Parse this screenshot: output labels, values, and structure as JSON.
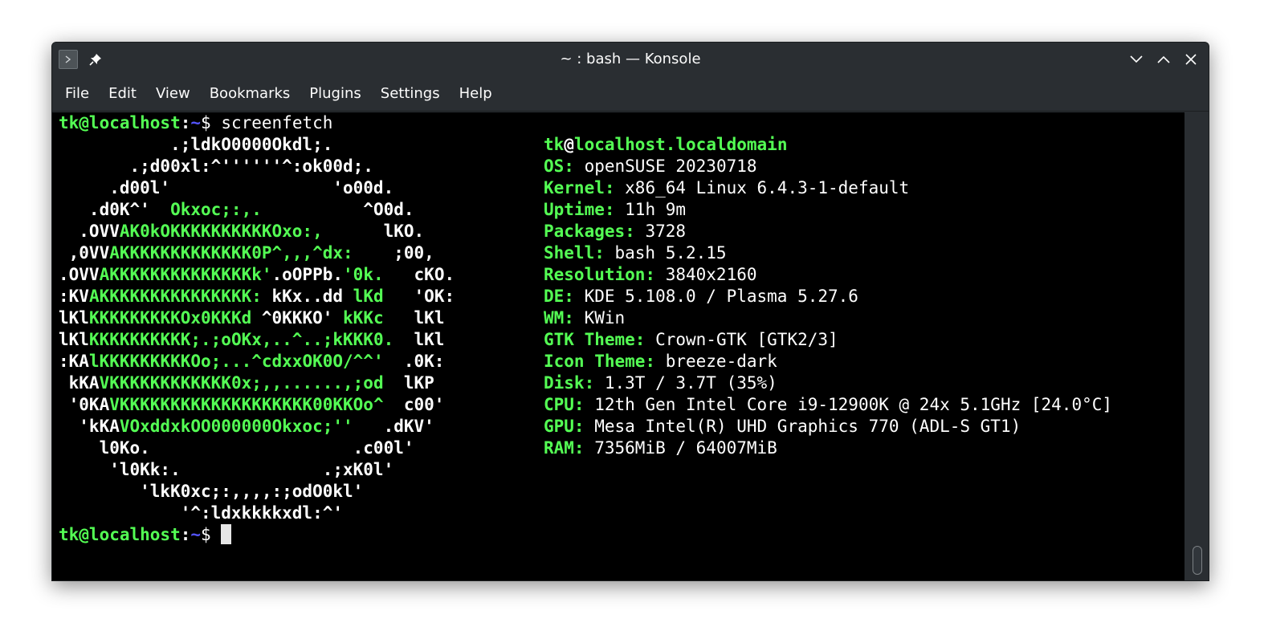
{
  "window": {
    "title": "~ : bash — Konsole"
  },
  "menubar": {
    "items": [
      "File",
      "Edit",
      "View",
      "Bookmarks",
      "Plugins",
      "Settings",
      "Help"
    ]
  },
  "prompt": {
    "user_host": "tk@localhost",
    "sep": ":",
    "path": "~",
    "symbol": "$ ",
    "command": "screenfetch"
  },
  "logo": [
    [
      {
        "t": "           .;ldkO0000Okdl;.",
        "c": "wb"
      }
    ],
    [
      {
        "t": "       .;d00xl:^''''''^:ok00d;.",
        "c": "wb"
      }
    ],
    [
      {
        "t": "     .d00l'                'o00d.",
        "c": "wb"
      }
    ],
    [
      {
        "t": "   .d0K^'  ",
        "c": "wb"
      },
      {
        "t": "Okxoc;:,.",
        "c": "g"
      },
      {
        "t": "          ^O0d.",
        "c": "wb"
      }
    ],
    [
      {
        "t": "  .OVV",
        "c": "wb"
      },
      {
        "t": "AK0kOKKKKKKKKKKOxo:,",
        "c": "g"
      },
      {
        "t": "      lKO.",
        "c": "wb"
      }
    ],
    [
      {
        "t": " ,0VV",
        "c": "wb"
      },
      {
        "t": "AKKKKKKKKKKKKK0P^,,,^dx:",
        "c": "g"
      },
      {
        "t": "    ;00,",
        "c": "wb"
      }
    ],
    [
      {
        "t": ".OVV",
        "c": "wb"
      },
      {
        "t": "AKKKKKKKKKKKKKKk'",
        "c": "g"
      },
      {
        "t": ".oOPPb.",
        "c": "wb"
      },
      {
        "t": "'0k.",
        "c": "g"
      },
      {
        "t": "   cKO.",
        "c": "wb"
      }
    ],
    [
      {
        "t": ":KV",
        "c": "wb"
      },
      {
        "t": "AKKKKKKKKKKKKKKK:",
        "c": "g"
      },
      {
        "t": " kKx..dd ",
        "c": "wb"
      },
      {
        "t": "lKd",
        "c": "g"
      },
      {
        "t": "   'OK:",
        "c": "wb"
      }
    ],
    [
      {
        "t": "lKl",
        "c": "wb"
      },
      {
        "t": "KKKKKKKKKOx0KKKd",
        "c": "g"
      },
      {
        "t": " ^0KKKO' ",
        "c": "wb"
      },
      {
        "t": "kKKc",
        "c": "g"
      },
      {
        "t": "   lKl",
        "c": "wb"
      }
    ],
    [
      {
        "t": "lKl",
        "c": "wb"
      },
      {
        "t": "KKKKKKKKKK;.;oOKx,..^..;kKKK0.",
        "c": "g"
      },
      {
        "t": "  lKl",
        "c": "wb"
      }
    ],
    [
      {
        "t": ":KA",
        "c": "wb"
      },
      {
        "t": "lKKKKKKKKKOo;...^cdxxOK0O/^^'",
        "c": "g"
      },
      {
        "t": "  .0K:",
        "c": "wb"
      }
    ],
    [
      {
        "t": " kKA",
        "c": "wb"
      },
      {
        "t": "VKKKKKKKKKKKK0x;,,......,;od",
        "c": "g"
      },
      {
        "t": "  lKP",
        "c": "wb"
      }
    ],
    [
      {
        "t": " '0KA",
        "c": "wb"
      },
      {
        "t": "VKKKKKKKKKKKKKKKKKKK00KKOo^",
        "c": "g"
      },
      {
        "t": "  c00'",
        "c": "wb"
      }
    ],
    [
      {
        "t": "  'kKA",
        "c": "wb"
      },
      {
        "t": "VOxddxkOO000000Okxoc;''",
        "c": "g"
      },
      {
        "t": "   .dKV'",
        "c": "wb"
      }
    ],
    [
      {
        "t": "    l0Ko.                    .c00l'",
        "c": "wb"
      }
    ],
    [
      {
        "t": "     'l0Kk:.              .;xK0l'",
        "c": "wb"
      }
    ],
    [
      {
        "t": "        'lkK0xc;:,,,,:;odO0kl'",
        "c": "wb"
      }
    ],
    [
      {
        "t": "            '^:ldxkkkkxdl:^'",
        "c": "wb"
      }
    ]
  ],
  "info": {
    "user": "tk",
    "at": "@",
    "host": "localhost.localdomain",
    "rows": [
      {
        "key": "OS:",
        "value": " openSUSE 20230718"
      },
      {
        "key": "Kernel:",
        "value": " x86_64 Linux 6.4.3-1-default"
      },
      {
        "key": "Uptime:",
        "value": " 11h 9m"
      },
      {
        "key": "Packages:",
        "value": " 3728"
      },
      {
        "key": "Shell:",
        "value": " bash 5.2.15"
      },
      {
        "key": "Resolution:",
        "value": " 3840x2160"
      },
      {
        "key": "DE:",
        "value": " KDE 5.108.0 / Plasma 5.27.6"
      },
      {
        "key": "WM:",
        "value": " KWin"
      },
      {
        "key": "GTK Theme:",
        "value": " Crown-GTK [GTK2/3]"
      },
      {
        "key": "Icon Theme:",
        "value": " breeze-dark"
      },
      {
        "key": "Disk:",
        "value": " 1.3T / 3.7T (35%)"
      },
      {
        "key": "CPU:",
        "value": " 12th Gen Intel Core i9-12900K @ 24x 5.1GHz [24.0°C]"
      },
      {
        "key": "GPU:",
        "value": " Mesa Intel(R) UHD Graphics 770 (ADL-S GT1)"
      },
      {
        "key": "RAM:",
        "value": " 7356MiB / 64007MiB"
      }
    ]
  },
  "colors": {
    "prompt_green": "#54ff54",
    "path_blue": "#5454ff",
    "terminal_bg": "#000000",
    "chrome_bg": "#2a2e32"
  },
  "icons": {
    "app": "terminal-icon",
    "pin": "pin-icon",
    "minimize": "chevron-down-icon",
    "maximize": "chevron-up-icon",
    "close": "close-icon"
  }
}
